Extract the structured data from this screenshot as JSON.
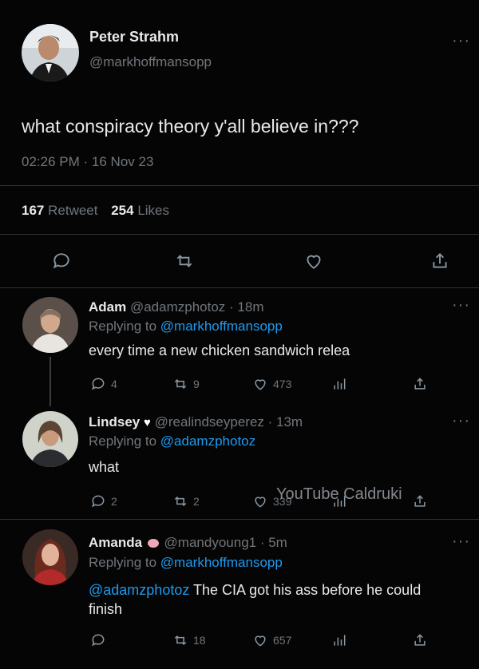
{
  "tweet": {
    "display_name": "Peter Strahm",
    "handle": "@markhoffmansopp",
    "text": "what conspiracy theory y'all believe in???",
    "time": "02:26 PM",
    "date": "16 Nov 23",
    "meta_sep": "·",
    "retweets_count": "167",
    "retweets_label": "Retweet",
    "likes_count": "254",
    "likes_label": "Likes",
    "more": "···"
  },
  "replies": [
    {
      "name": "Adam",
      "handle": "@adamzphotoz",
      "time": "· 18m",
      "replying_label": "Replying to",
      "replying_to": "@markhoffmansopp",
      "text": "every time a new chicken sandwich relea",
      "replies": "4",
      "retweets": "9",
      "likes": "473",
      "more": "···"
    },
    {
      "name": "Lindsey",
      "handle": "@realindseyperez",
      "time": "· 13m",
      "replying_label": "Replying to",
      "replying_to": "@adamzphotoz",
      "text": "what",
      "replies": "2",
      "retweets": "2",
      "likes": "339",
      "more": "···"
    },
    {
      "name": "Amanda",
      "handle": "@mandyoung1",
      "time": "· 5m",
      "replying_label": "Replying to",
      "replying_to": "@markhoffmansopp",
      "mention": "@adamzphotoz",
      "text_line1": "The CIA got his ass before he could",
      "text_line2": "finish",
      "retweets": "18",
      "likes": "657",
      "more": "···"
    }
  ],
  "watermark": "YouTube Caldruki",
  "colors": {
    "background": "#050505",
    "text": "#e7e9ea",
    "muted": "#71767b",
    "link": "#1d9bf0",
    "divider": "#2f3336"
  }
}
